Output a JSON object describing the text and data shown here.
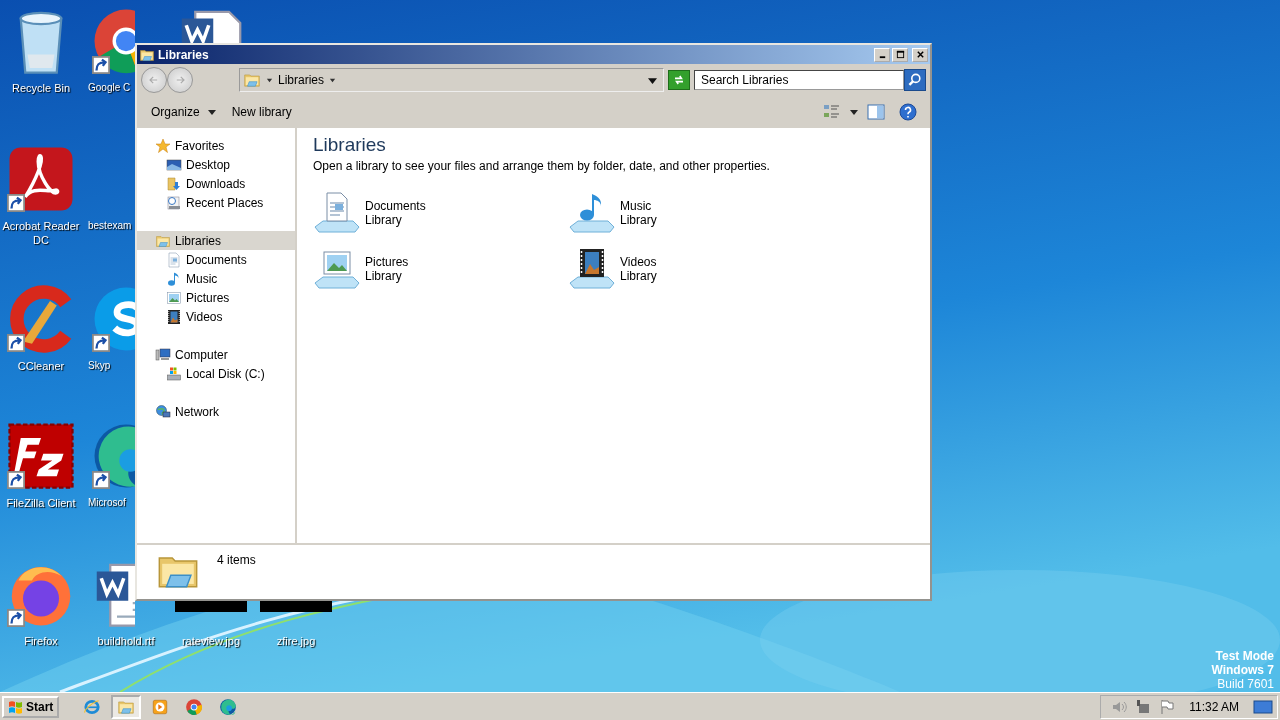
{
  "desktop": {
    "icons": [
      {
        "kind": "recycle",
        "label": "Recycle Bin"
      },
      {
        "kind": "chrome",
        "label": "Google C",
        "shortcut": true
      },
      {
        "kind": "word"
      },
      {
        "kind": "acrobat",
        "label": "Acrobat Reader DC",
        "shortcut": true
      },
      {
        "kind": "blank",
        "label": "bestexam"
      },
      {
        "kind": "ccleaner",
        "label": "CCleaner",
        "shortcut": true
      },
      {
        "kind": "skype",
        "label": "Skyp",
        "shortcut": true
      },
      {
        "kind": "filezilla",
        "label": "FileZilla Client",
        "shortcut": true
      },
      {
        "kind": "edge",
        "label": "Microsof",
        "shortcut": true
      },
      {
        "kind": "firefox",
        "label": "Firefox",
        "shortcut": true
      },
      {
        "kind": "word",
        "label": "buildhold.rtf"
      },
      {
        "kind": "image",
        "label": "rateview.jpg"
      },
      {
        "kind": "image",
        "label": "zfire.jpg"
      }
    ],
    "edition": [
      "Test Mode",
      "Windows 7",
      "Build 7601"
    ]
  },
  "window": {
    "title": "Libraries",
    "address": {
      "crumbs": [
        "Libraries"
      ]
    },
    "search": {
      "placeholder": "Search Libraries"
    },
    "toolbar": [
      {
        "label": "Organize",
        "menu": true
      },
      {
        "label": "New library",
        "menu": false
      }
    ],
    "nav": [
      {
        "label": "Favorites",
        "kind": "star",
        "selected": false,
        "children": [
          {
            "label": "Desktop",
            "kind": "desktop",
            "selected": false
          },
          {
            "label": "Downloads",
            "kind": "downloads",
            "selected": false
          },
          {
            "label": "Recent Places",
            "kind": "recent",
            "selected": false
          }
        ]
      },
      {
        "label": "Libraries",
        "kind": "library",
        "selected": true,
        "children": [
          {
            "label": "Documents",
            "kind": "documents",
            "selected": false
          },
          {
            "label": "Music",
            "kind": "music",
            "selected": false
          },
          {
            "label": "Pictures",
            "kind": "pictures",
            "selected": false
          },
          {
            "label": "Videos",
            "kind": "videos",
            "selected": false
          }
        ]
      },
      {
        "label": "Computer",
        "kind": "computer",
        "selected": false,
        "children": [
          {
            "label": "Local Disk (C:)",
            "kind": "disk",
            "selected": false
          }
        ]
      },
      {
        "label": "Network",
        "kind": "network",
        "selected": false
      }
    ],
    "content": {
      "heading": "Libraries",
      "description": "Open a library to see your files and arrange them by folder, date, and other properties.",
      "items": [
        {
          "name": "Documents",
          "type": "Library",
          "kind": "documents"
        },
        {
          "name": "Music",
          "type": "Library",
          "kind": "music"
        },
        {
          "name": "Pictures",
          "type": "Library",
          "kind": "pictures"
        },
        {
          "name": "Videos",
          "type": "Library",
          "kind": "videos"
        }
      ]
    },
    "details": {
      "count": "4 items"
    }
  },
  "taskbar": {
    "start": "Start",
    "apps": [
      {
        "kind": "ie",
        "selected": false
      },
      {
        "kind": "explorer",
        "selected": true
      },
      {
        "kind": "media",
        "selected": false
      },
      {
        "kind": "chrome",
        "selected": false
      },
      {
        "kind": "edge",
        "selected": false
      }
    ],
    "tray": {
      "time": "11:32 AM"
    }
  }
}
